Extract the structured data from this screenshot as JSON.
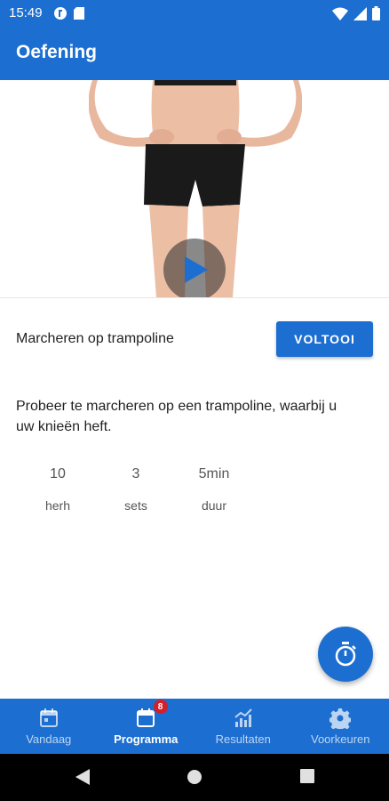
{
  "status_bar": {
    "time": "15:49"
  },
  "app_bar": {
    "title": "Oefening"
  },
  "exercise": {
    "name": "Marcheren op trampoline",
    "complete_label": "VOLTOOI",
    "description": "Probeer te marcheren op een trampoline, waarbij u uw knieën heft.",
    "stats": [
      {
        "value": "10",
        "label": "herh"
      },
      {
        "value": "3",
        "label": "sets"
      },
      {
        "value": "5min",
        "label": "duur"
      }
    ]
  },
  "fab": {
    "icon": "stopwatch-icon"
  },
  "bottom_nav": {
    "items": [
      {
        "label": "Vandaag",
        "icon": "calendar-icon",
        "active": false
      },
      {
        "label": "Programma",
        "icon": "calendar-blank-icon",
        "active": true,
        "badge": "8"
      },
      {
        "label": "Resultaten",
        "icon": "chart-icon",
        "active": false
      },
      {
        "label": "Voorkeuren",
        "icon": "gear-icon",
        "active": false
      }
    ]
  },
  "colors": {
    "primary": "#1c6fd1",
    "badge": "#d21f2a",
    "text": "#222222",
    "muted": "#555555"
  }
}
